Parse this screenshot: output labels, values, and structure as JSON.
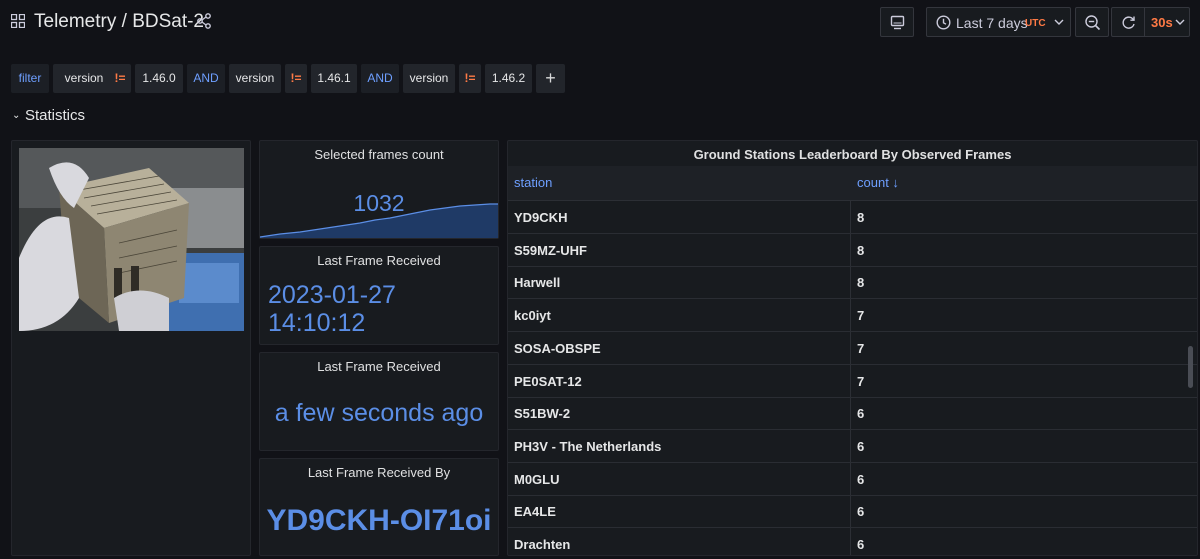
{
  "header": {
    "title": "Telemetry / BDSat-2",
    "time_range": "Last 7 days",
    "timezone": "UTC",
    "refresh_interval": "30s"
  },
  "filters": [
    {
      "text": "filter",
      "kind": "kw"
    },
    {
      "text": "version",
      "kind": "key"
    },
    {
      "text": "!=",
      "kind": "op"
    },
    {
      "text": "1.46.0",
      "kind": "value"
    },
    {
      "text": "AND",
      "kind": "kw"
    },
    {
      "text": "version",
      "kind": "key"
    },
    {
      "text": "!=",
      "kind": "op"
    },
    {
      "text": "1.46.1",
      "kind": "value"
    },
    {
      "text": "AND",
      "kind": "kw"
    },
    {
      "text": "version",
      "kind": "key"
    },
    {
      "text": "!=",
      "kind": "op"
    },
    {
      "text": "1.46.2",
      "kind": "value"
    }
  ],
  "add_filter_label": "+",
  "row_title": "Statistics",
  "stats": {
    "frames_title": "Selected frames count",
    "frames_value": "1032",
    "last_frame_title": "Last Frame Received",
    "last_frame_date": "2023-01-27",
    "last_frame_time": "14:10:12",
    "last_frame_rel_title": "Last Frame Received",
    "last_frame_rel_value": "a few seconds ago",
    "last_by_title": "Last Frame Received By",
    "last_by_value": "YD9CKH-OI71oi"
  },
  "leaderboard": {
    "title": "Ground Stations Leaderboard By Observed Frames",
    "col_station": "station",
    "col_count": "count ↓",
    "rows": [
      {
        "station": "YD9CKH",
        "count": "8"
      },
      {
        "station": "S59MZ-UHF",
        "count": "8"
      },
      {
        "station": "Harwell",
        "count": "8"
      },
      {
        "station": "kc0iyt",
        "count": "7"
      },
      {
        "station": "SOSA-OBSPE",
        "count": "7"
      },
      {
        "station": "PE0SAT-12",
        "count": "7"
      },
      {
        "station": "S51BW-2",
        "count": "6"
      },
      {
        "station": "PH3V - The Netherlands",
        "count": "6"
      },
      {
        "station": "M0GLU",
        "count": "6"
      },
      {
        "station": "EA4LE",
        "count": "6"
      },
      {
        "station": "Drachten",
        "count": "6"
      }
    ]
  },
  "colors": {
    "background": "#111217",
    "panel": "#181b1f",
    "stat_blue": "#5b8ee6",
    "accent_orange": "#ff7a45",
    "link_blue": "#6e9fff"
  }
}
